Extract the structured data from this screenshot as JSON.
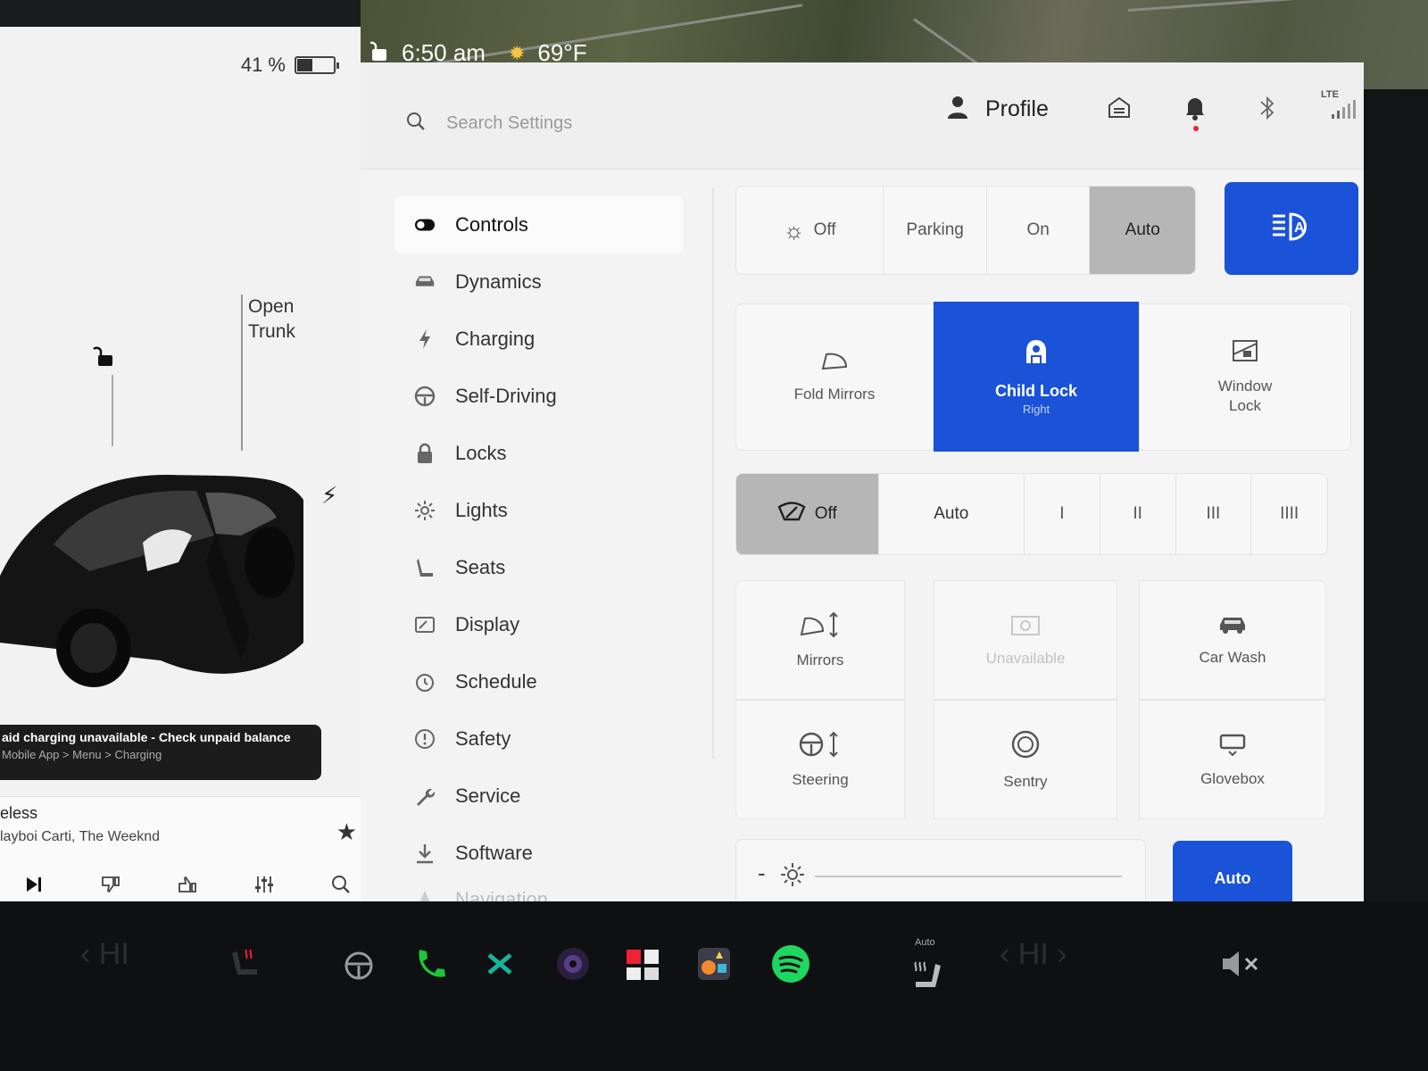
{
  "status": {
    "time": "6:50 am",
    "temp": "69°F",
    "battery_pct": "41 %",
    "battery_level": 0.41
  },
  "car": {
    "trunk_label_1": "Open",
    "trunk_label_2": "Trunk"
  },
  "alert": {
    "line1": "aid charging unavailable - Check unpaid balance",
    "line2": "Mobile App > Menu > Charging"
  },
  "media": {
    "song": "eless",
    "artist": "layboi Carti, The Weeknd"
  },
  "topbar": {
    "search_placeholder": "Search Settings",
    "profile": "Profile",
    "lte": "LTE"
  },
  "nav": [
    {
      "label": "Controls",
      "icon": "toggle-icon"
    },
    {
      "label": "Dynamics",
      "icon": "car-icon"
    },
    {
      "label": "Charging",
      "icon": "bolt-icon"
    },
    {
      "label": "Self-Driving",
      "icon": "steering-wheel-icon"
    },
    {
      "label": "Locks",
      "icon": "lock-icon"
    },
    {
      "label": "Lights",
      "icon": "sun-icon"
    },
    {
      "label": "Seats",
      "icon": "seat-icon"
    },
    {
      "label": "Display",
      "icon": "display-icon"
    },
    {
      "label": "Schedule",
      "icon": "schedule-icon"
    },
    {
      "label": "Safety",
      "icon": "safety-icon"
    },
    {
      "label": "Service",
      "icon": "wrench-icon"
    },
    {
      "label": "Software",
      "icon": "download-icon"
    },
    {
      "label": "Navigation",
      "icon": "navigation-icon"
    }
  ],
  "headlights": {
    "off": "Off",
    "parking": "Parking",
    "on": "On",
    "auto": "Auto",
    "selected": "Auto"
  },
  "tiles_row1": {
    "fold_mirrors": "Fold Mirrors",
    "child_lock": "Child Lock",
    "child_lock_sub": "Right",
    "window_lock_1": "Window",
    "window_lock_2": "Lock"
  },
  "wipers": {
    "off": "Off",
    "auto": "Auto",
    "s1": "I",
    "s2": "II",
    "s3": "III",
    "s4": "IIII",
    "selected": "Off"
  },
  "tiles_grid": {
    "mirrors": "Mirrors",
    "unavailable": "Unavailable",
    "car_wash": "Car Wash",
    "steering": "Steering",
    "sentry": "Sentry",
    "glovebox": "Glovebox"
  },
  "brightness": {
    "auto": "Auto",
    "minus": "-"
  },
  "dock": {
    "seat_heat_auto": "Auto"
  },
  "colors": {
    "accent_blue": "#1a52d8",
    "selected_gray": "#b6b6b6"
  }
}
